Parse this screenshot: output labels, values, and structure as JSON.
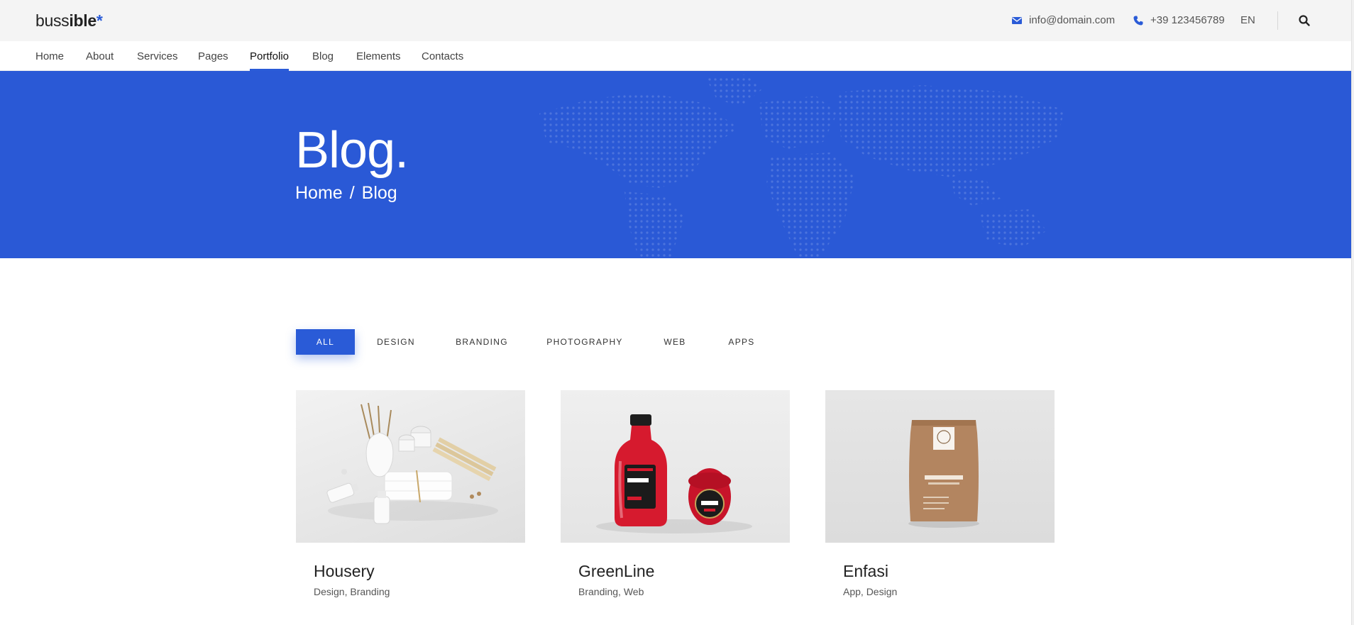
{
  "header": {
    "logo": {
      "part1": "buss",
      "part2": "ible",
      "star": "*"
    },
    "email": "info@domain.com",
    "phone": "+39 123456789",
    "language": "EN",
    "icons": {
      "email": "envelope-icon",
      "phone": "phone-icon",
      "search": "search-icon"
    }
  },
  "nav": {
    "items": [
      {
        "label": "Home"
      },
      {
        "label": "About"
      },
      {
        "label": "Services"
      },
      {
        "label": "Pages"
      },
      {
        "label": "Portfolio",
        "active": true
      },
      {
        "label": "Blog"
      },
      {
        "label": "Elements"
      },
      {
        "label": "Contacts"
      }
    ]
  },
  "hero": {
    "title": "Blog.",
    "breadcrumb": {
      "home": "Home",
      "separator": "/",
      "current": "Blog"
    },
    "background": "#2a59d6"
  },
  "filters": [
    {
      "label": "ALL",
      "active": true
    },
    {
      "label": "DESIGN"
    },
    {
      "label": "BRANDING"
    },
    {
      "label": "PHOTOGRAPHY"
    },
    {
      "label": "WEB"
    },
    {
      "label": "APPS"
    }
  ],
  "portfolio": [
    {
      "title": "Housery",
      "tags": "Design, Branding"
    },
    {
      "title": "GreenLine",
      "tags": "Branding, Web"
    },
    {
      "title": "Enfasi",
      "tags": "App, Design"
    }
  ],
  "colors": {
    "accent": "#2a5bd7",
    "topbar": "#f4f4f4"
  }
}
